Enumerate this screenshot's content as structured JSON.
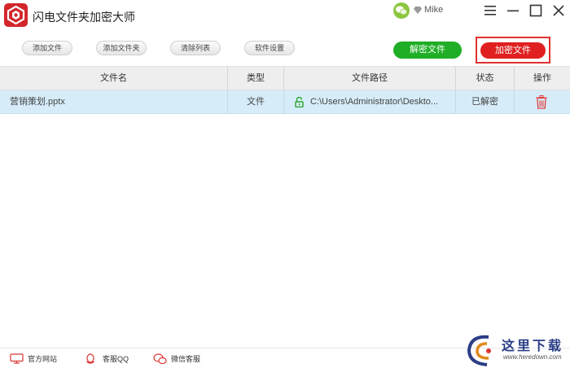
{
  "app": {
    "title": "闪电文件夹加密大师"
  },
  "user": {
    "name": "Mike",
    "wechat_icon": "wechat-icon",
    "vip_icon": "vip-diamond-icon"
  },
  "window_controls": {
    "menu": "menu-icon",
    "minimize": "minimize-icon",
    "maximize": "maximize-icon",
    "close": "close-icon"
  },
  "toolbar": {
    "add_file": "添加文件",
    "add_folder": "添加文件夹",
    "clear_list": "清除列表",
    "settings": "软件设置",
    "decrypt": "解密文件",
    "encrypt": "加密文件"
  },
  "table": {
    "columns": [
      "文件名",
      "类型",
      "文件路径",
      "状态",
      "操作"
    ],
    "rows": [
      {
        "name": "营销策划.pptx",
        "type": "文件",
        "path": "C:\\Users\\Administrator\\Deskto...",
        "status": "已解密",
        "lock_icon": "unlock-icon",
        "action_icon": "trash-icon"
      }
    ]
  },
  "footer": {
    "official_site": "官方网站",
    "qq_support": "客服QQ",
    "wechat_support": "微信客服"
  },
  "watermark": {
    "text": "这里下载",
    "url": "www.heredown.com"
  },
  "colors": {
    "accent_red": "#e02020",
    "accent_green": "#1fae25",
    "row_selected": "#d6ecf8",
    "header_bg": "#eeeeee"
  }
}
